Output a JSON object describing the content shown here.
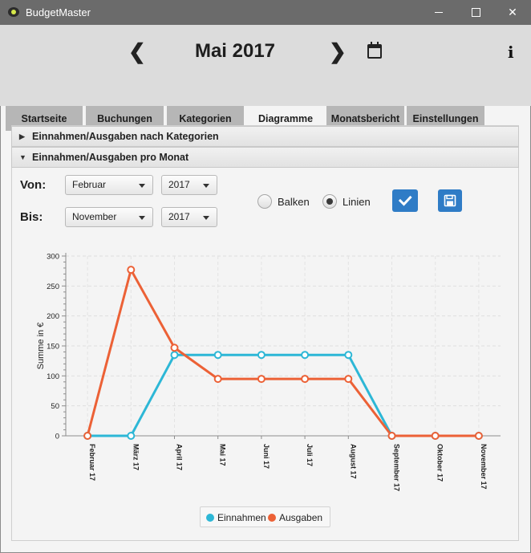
{
  "window": {
    "title": "BudgetMaster"
  },
  "header": {
    "month_title": "Mai 2017"
  },
  "tabs": [
    {
      "label": "Startseite"
    },
    {
      "label": "Buchungen"
    },
    {
      "label": "Kategorien"
    },
    {
      "label": "Diagramme"
    },
    {
      "label": "Monatsbericht"
    },
    {
      "label": "Einstellungen"
    }
  ],
  "active_tab": "Diagramme",
  "accordions": [
    {
      "label": "Einnahmen/Ausgaben nach Kategorien",
      "expanded": false
    },
    {
      "label": "Einnahmen/Ausgaben pro Monat",
      "expanded": true
    }
  ],
  "filters": {
    "from_label": "Von:",
    "to_label": "Bis:",
    "from_month": "Februar",
    "from_year": "2017",
    "to_month": "November",
    "to_year": "2017"
  },
  "chart_type_options": {
    "bars_label": "Balken",
    "lines_label": "Linien",
    "selected": "Linien"
  },
  "colors": {
    "accent_button": "#2f7cc6",
    "series_income": "#2db7d6",
    "series_expense": "#ec6136"
  },
  "chart_data": {
    "type": "line",
    "title": "",
    "xlabel": "",
    "ylabel": "Summe in €",
    "categories": [
      "Februar 17",
      "März 17",
      "April 17",
      "Mai 17",
      "Juni 17",
      "Juli 17",
      "August 17",
      "September 17",
      "Oktober 17",
      "November 17"
    ],
    "ylim": [
      0,
      300
    ],
    "yticks": [
      0,
      50,
      100,
      150,
      200,
      250,
      300
    ],
    "grid": true,
    "legend": "bottom",
    "series": [
      {
        "name": "Einnahmen",
        "color": "#2db7d6",
        "values": [
          0,
          0,
          135,
          135,
          135,
          135,
          135,
          0,
          0,
          0
        ]
      },
      {
        "name": "Ausgaben",
        "color": "#ec6136",
        "values": [
          0,
          277,
          147,
          95,
          95,
          95,
          95,
          0,
          0,
          0
        ]
      }
    ]
  }
}
